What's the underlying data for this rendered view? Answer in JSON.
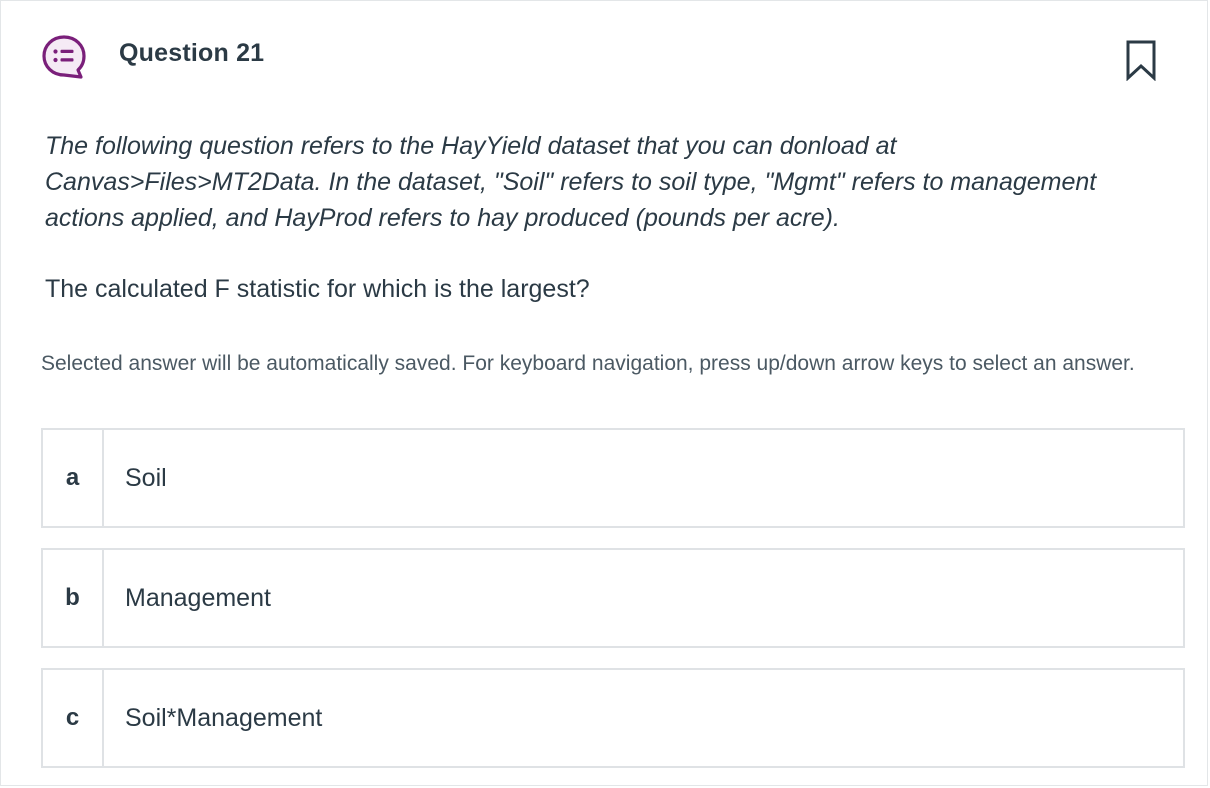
{
  "question": {
    "title": "Question 21",
    "icon": "question-list-icon",
    "bookmark_icon": "bookmark-icon",
    "prompt": "The following question refers to the HayYield dataset that you can donload at Canvas>Files>MT2Data. In the dataset, \"Soil\" refers to soil type, \"Mgmt\" refers to management actions applied, and HayProd refers to hay produced (pounds per acre).",
    "stem": "The calculated F statistic for which is the largest?",
    "instructions": "Selected answer will be automatically saved. For keyboard navigation, press up/down arrow keys to select an answer."
  },
  "options": [
    {
      "letter": "a",
      "text": "Soil"
    },
    {
      "letter": "b",
      "text": "Management"
    },
    {
      "letter": "c",
      "text": "Soil*Management"
    }
  ],
  "colors": {
    "accent": "#7a1f7a",
    "text": "#2b3a45",
    "border": "#dfe2e5"
  }
}
